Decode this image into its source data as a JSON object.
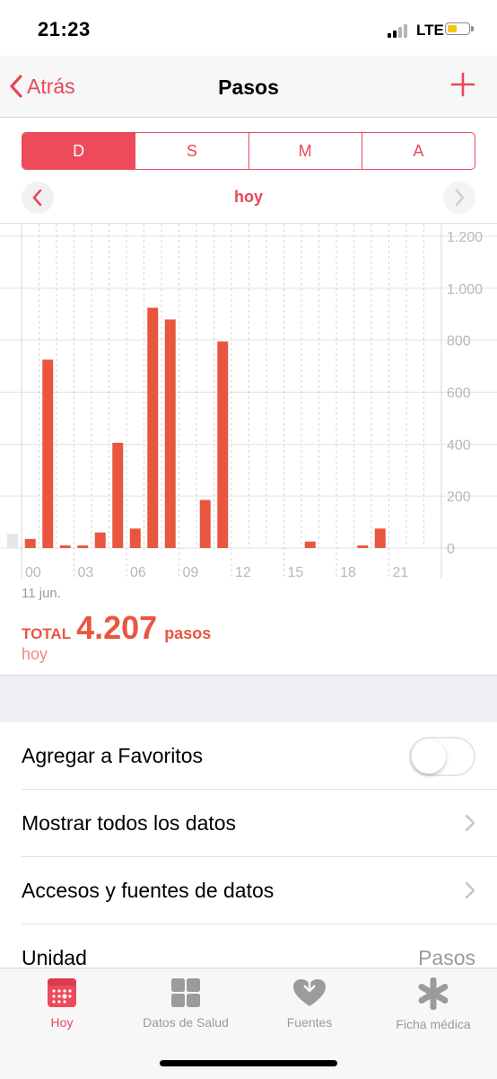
{
  "status_bar": {
    "time": "21:23",
    "network": "LTE",
    "battery_level": 0.45
  },
  "navbar": {
    "back_label": "Atrás",
    "title": "Pasos",
    "add_icon": "plus-icon"
  },
  "segments": [
    {
      "label": "D",
      "active": true
    },
    {
      "label": "S",
      "active": false
    },
    {
      "label": "M",
      "active": false
    },
    {
      "label": "A",
      "active": false
    }
  ],
  "period": {
    "label": "hoy"
  },
  "chart_data": {
    "type": "bar",
    "x_ticks": [
      "00",
      "03",
      "06",
      "09",
      "12",
      "15",
      "18",
      "21"
    ],
    "y_ticks": [
      "0",
      "200",
      "400",
      "600",
      "800",
      "1.000",
      "1.200"
    ],
    "ylim": [
      0,
      1200
    ],
    "bar_color": "#e9563f",
    "values": [
      35,
      725,
      10,
      10,
      60,
      405,
      75,
      925,
      880,
      0,
      185,
      795,
      0,
      0,
      0,
      0,
      25,
      0,
      0,
      10,
      75,
      0,
      0,
      0
    ],
    "prior_day_tail_value": 55,
    "date_label": "11 jun."
  },
  "total": {
    "prefix": "TOTAL",
    "value": "4.207",
    "unit": "pasos",
    "period": "hoy"
  },
  "settings": {
    "favorites_label": "Agregar a Favoritos",
    "favorites_on": false,
    "show_all_label": "Mostrar todos los datos",
    "sources_label": "Accesos y fuentes de datos",
    "unit_label": "Unidad",
    "unit_value": "Pasos"
  },
  "tabbar": {
    "tabs": [
      {
        "label": "Hoy",
        "icon": "calendar-icon",
        "active": true
      },
      {
        "label": "Datos de Salud",
        "icon": "grid-icon",
        "active": false
      },
      {
        "label": "Fuentes",
        "icon": "heart-icon",
        "active": false
      },
      {
        "label": "Ficha médica",
        "icon": "asterisk-icon",
        "active": false
      }
    ]
  },
  "colors": {
    "accent": "#e9475a",
    "bar": "#e9563f"
  }
}
